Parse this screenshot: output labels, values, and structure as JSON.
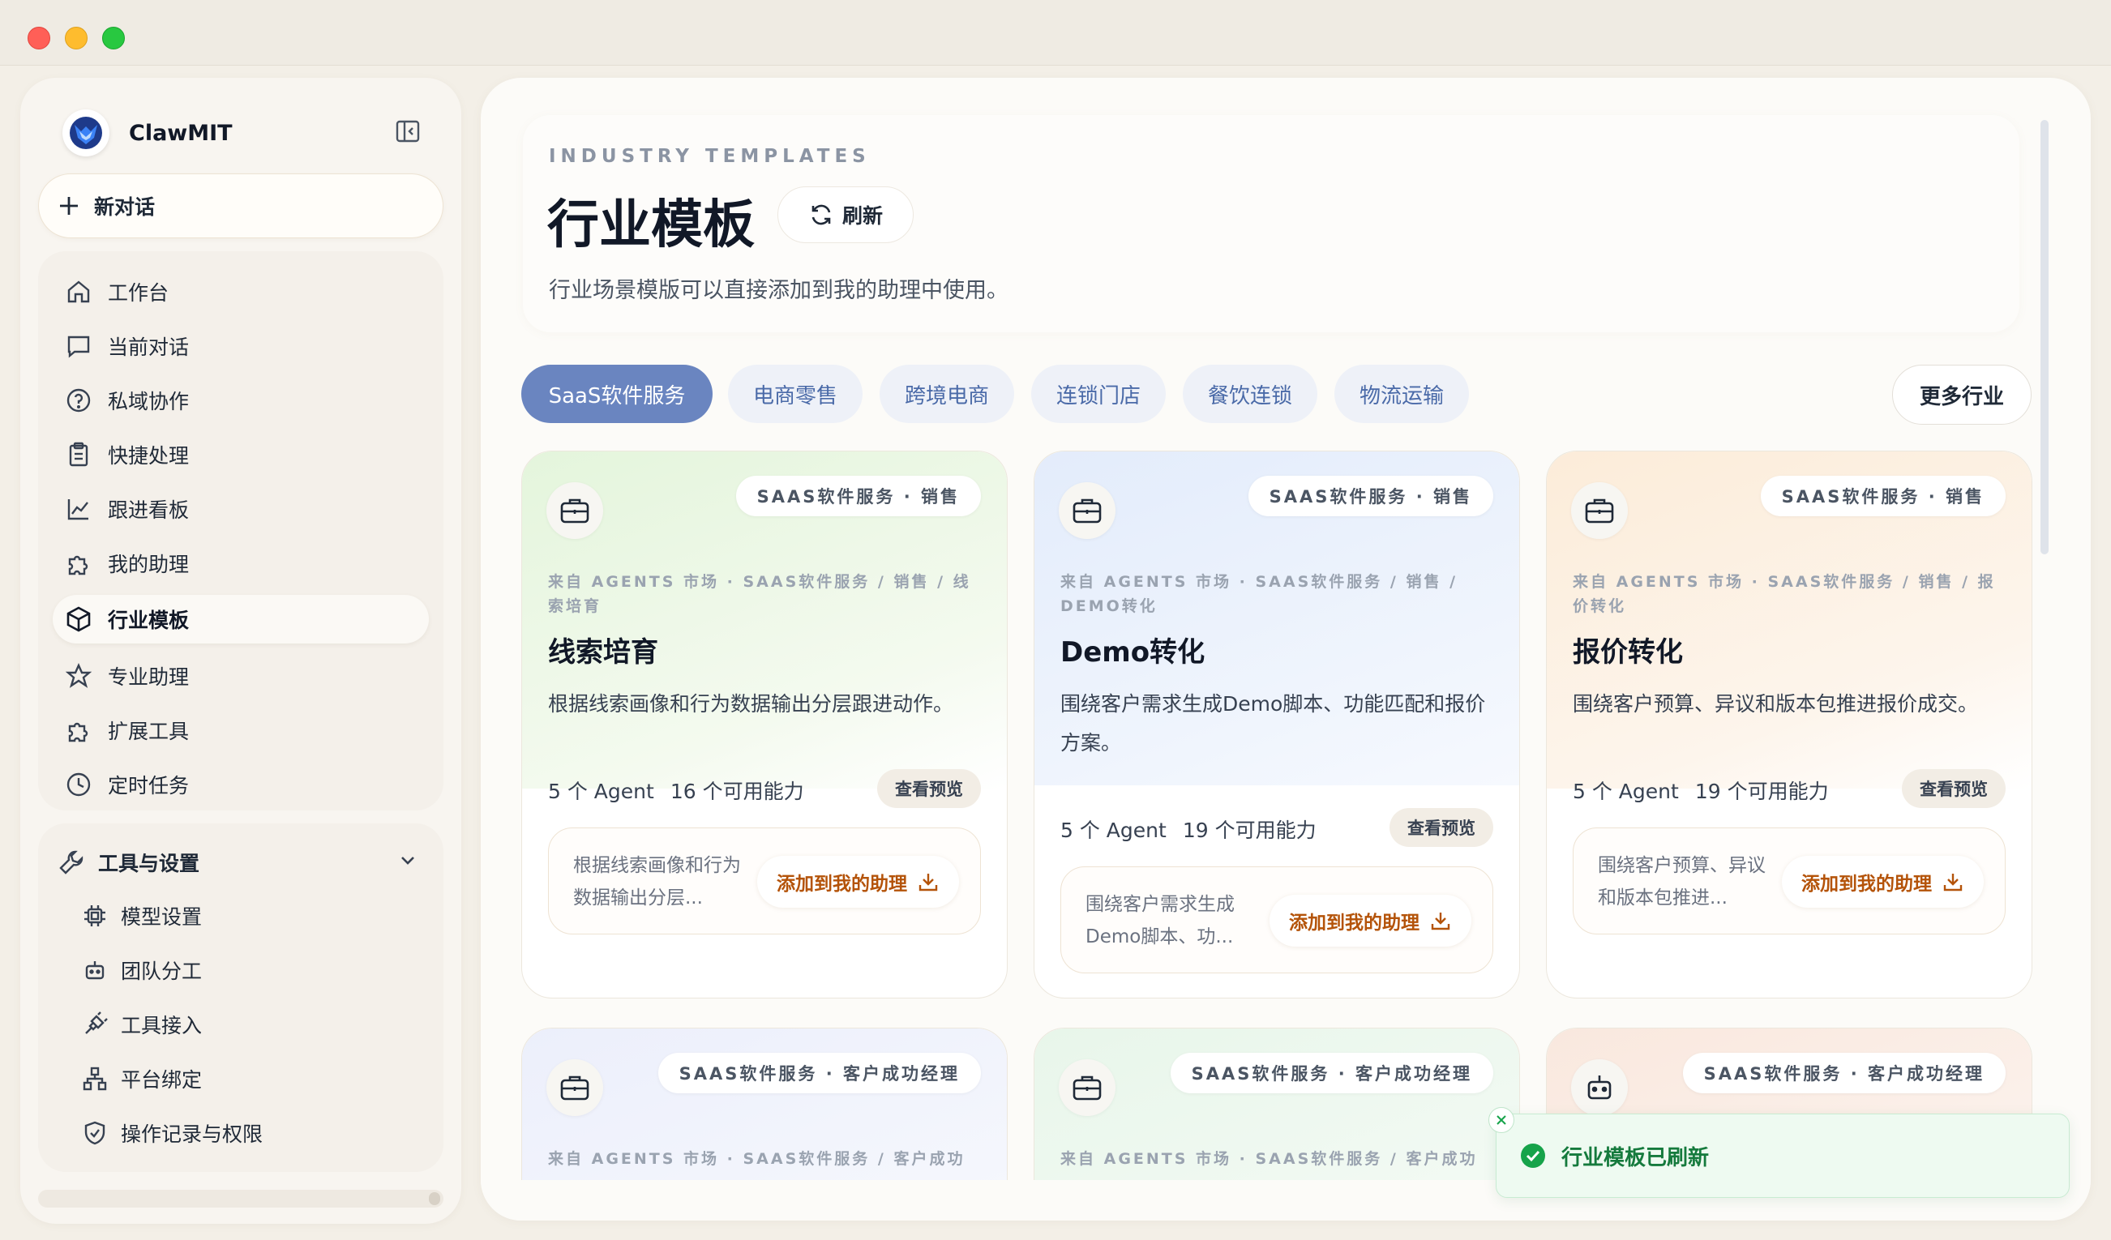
{
  "app": {
    "name": "ClawMIT"
  },
  "sidebar": {
    "new_chat": "新对话",
    "items": [
      {
        "label": "工作台",
        "icon": "home-icon"
      },
      {
        "label": "当前对话",
        "icon": "chat-icon"
      },
      {
        "label": "私域协作",
        "icon": "help-circle-icon"
      },
      {
        "label": "快捷处理",
        "icon": "clipboard-icon"
      },
      {
        "label": "跟进看板",
        "icon": "chart-line-icon"
      },
      {
        "label": "我的助理",
        "icon": "puzzle-icon"
      },
      {
        "label": "行业模板",
        "icon": "cube-icon",
        "active": true
      },
      {
        "label": "专业助理",
        "icon": "star-icon"
      },
      {
        "label": "扩展工具",
        "icon": "puzzle-icon"
      },
      {
        "label": "定时任务",
        "icon": "clock-icon"
      }
    ],
    "tools": {
      "title": "工具与设置",
      "items": [
        {
          "label": "模型设置",
          "icon": "chip-icon"
        },
        {
          "label": "团队分工",
          "icon": "robot-icon"
        },
        {
          "label": "工具接入",
          "icon": "plug-icon"
        },
        {
          "label": "平台绑定",
          "icon": "network-icon"
        },
        {
          "label": "操作记录与权限",
          "icon": "shield-check-icon"
        }
      ]
    }
  },
  "header": {
    "eyebrow": "INDUSTRY TEMPLATES",
    "title": "行业模板",
    "refresh": "刷新",
    "description": "行业场景模版可以直接添加到我的助理中使用。"
  },
  "tabs": [
    "SaaS软件服务",
    "电商零售",
    "跨境电商",
    "连锁门店",
    "餐饮连锁",
    "物流运输"
  ],
  "active_tab": "SaaS软件服务",
  "more_button": "更多行业",
  "cards": [
    {
      "badge": "SAAS软件服务 · 销售",
      "source": "来自 AGENTS 市场 · SAAS软件服务 / 销售 / 线索培育",
      "title": "线索培育",
      "description": "根据线索画像和行为数据输出分层跟进动作。",
      "meta_agents": "5 个 Agent",
      "meta_abilities": "16 个可用能力",
      "preview": "查看预览",
      "action_text": "根据线索画像和行为数据输出分层...",
      "add_label": "添加到我的助理",
      "tint": "#eaf6e4"
    },
    {
      "badge": "SAAS软件服务 · 销售",
      "source": "来自 AGENTS 市场 · SAAS软件服务 / 销售 / DEMO转化",
      "title": "Demo转化",
      "description": "围绕客户需求生成Demo脚本、功能匹配和报价方案。",
      "meta_agents": "5 个 Agent",
      "meta_abilities": "19 个可用能力",
      "preview": "查看预览",
      "action_text": "围绕客户需求生成Demo脚本、功...",
      "add_label": "添加到我的助理",
      "tint": "#e8f0fc"
    },
    {
      "badge": "SAAS软件服务 · 销售",
      "source": "来自 AGENTS 市场 · SAAS软件服务 / 销售 / 报价转化",
      "title": "报价转化",
      "description": "围绕客户预算、异议和版本包推进报价成交。",
      "meta_agents": "5 个 Agent",
      "meta_abilities": "19 个可用能力",
      "preview": "查看预览",
      "action_text": "围绕客户预算、异议和版本包推进...",
      "add_label": "添加到我的助理",
      "tint": "#fcf1e3"
    },
    {
      "badge": "SAAS软件服务 · 客户成功经理",
      "source": "来自 AGENTS 市场 · SAAS软件服务 / 客户成功",
      "tint": "#eef1fb"
    },
    {
      "badge": "SAAS软件服务 · 客户成功经理",
      "source": "来自 AGENTS 市场 · SAAS软件服务 / 客户成功",
      "tint": "#ecf7ee"
    },
    {
      "badge": "SAAS软件服务 · 客户成功经理",
      "tint": "#fbeee6"
    }
  ],
  "toast": {
    "message": "行业模板已刷新"
  },
  "colors": {
    "accent": "#6a85c0",
    "add_text": "#b45309",
    "toast_green": "#157a3d"
  }
}
